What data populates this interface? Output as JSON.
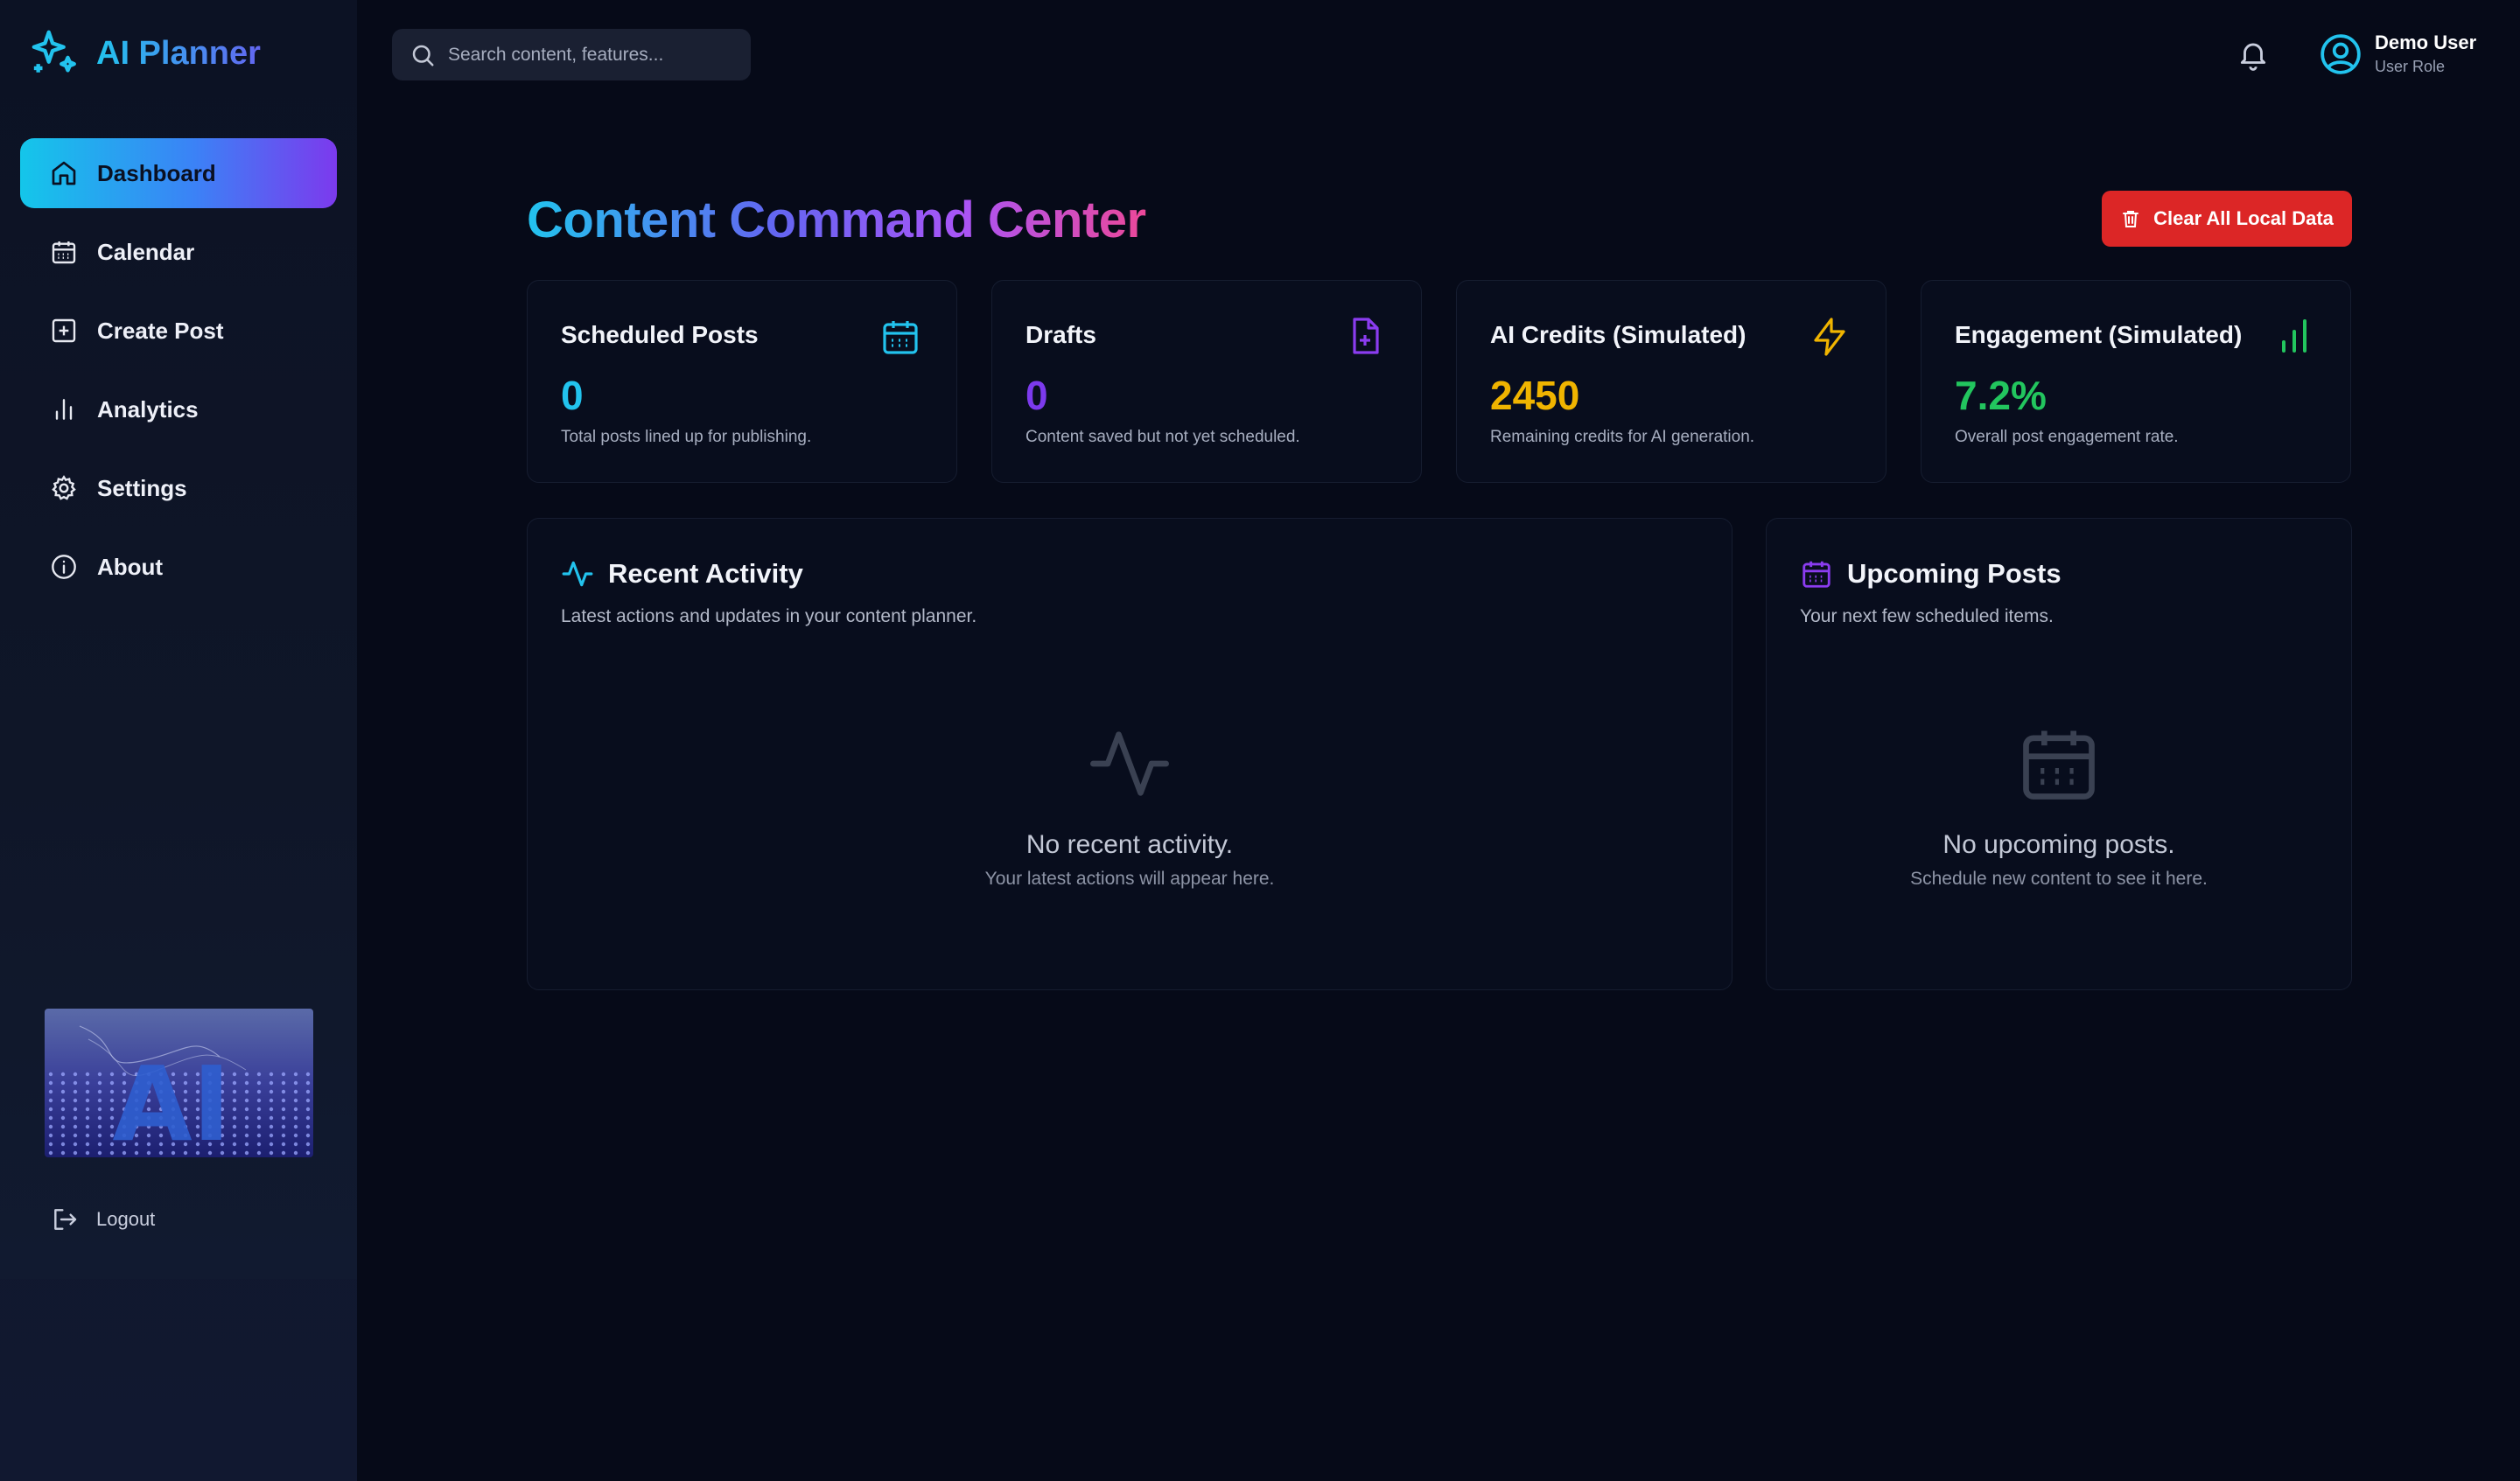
{
  "brand": {
    "name": "AI Planner",
    "icon": "sparkles-icon"
  },
  "sidebar": {
    "items": [
      {
        "label": "Dashboard",
        "icon": "home-icon",
        "active": true
      },
      {
        "label": "Calendar",
        "icon": "calendar-icon"
      },
      {
        "label": "Create Post",
        "icon": "plus-square-icon"
      },
      {
        "label": "Analytics",
        "icon": "bar-chart-icon"
      },
      {
        "label": "Settings",
        "icon": "gear-icon"
      },
      {
        "label": "About",
        "icon": "info-icon"
      }
    ],
    "image_text": "AI",
    "logout_label": "Logout"
  },
  "topbar": {
    "search_placeholder": "Search content, features...",
    "user_name": "Demo User",
    "user_role": "User Role"
  },
  "main": {
    "title_words": [
      "Content",
      "Command",
      "Center"
    ],
    "clear_button": "Clear All Local Data",
    "stats": [
      {
        "title": "Scheduled Posts",
        "value": "0",
        "desc": "Total posts lined up for publishing.",
        "color": "#22c3ee",
        "icon": "calendar-icon"
      },
      {
        "title": "Drafts",
        "value": "0",
        "desc": "Content saved but not yet scheduled.",
        "color": "#7c3aed",
        "icon": "file-plus-icon"
      },
      {
        "title": "AI Credits (Simulated)",
        "value": "2450",
        "desc": "Remaining credits for AI generation.",
        "color": "#f0b400",
        "icon": "lightning-icon"
      },
      {
        "title": "Engagement (Simulated)",
        "value": "7.2%",
        "desc": "Overall post engagement rate.",
        "color": "#22c55e",
        "icon": "signal-bars-icon"
      }
    ],
    "recent": {
      "title": "Recent Activity",
      "subtitle": "Latest actions and updates in your content planner.",
      "empty_title": "No recent activity.",
      "empty_sub": "Your latest actions will appear here."
    },
    "upcoming": {
      "title": "Upcoming Posts",
      "subtitle": "Your next few scheduled items.",
      "empty_title": "No upcoming posts.",
      "empty_sub": "Schedule new content to see it here."
    }
  },
  "colors": {
    "accent_cyan": "#22c3ee",
    "accent_purple": "#7c3aed",
    "danger": "#dc2626",
    "background": "#060a18"
  }
}
